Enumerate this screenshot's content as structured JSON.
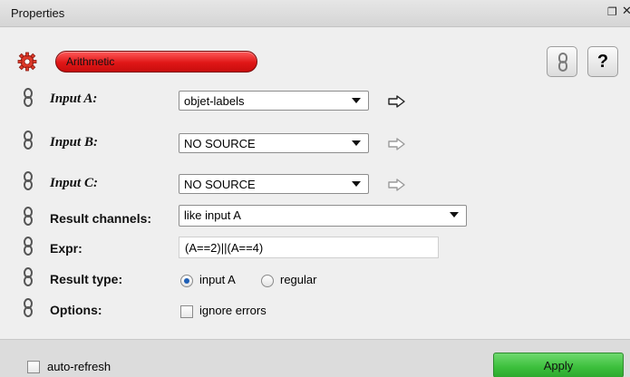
{
  "window": {
    "title": "Properties",
    "float_glyph": "❐",
    "close_glyph": "✕"
  },
  "header": {
    "module_name": "Arithmetic",
    "module_icon": "red-gear-icon",
    "link_icon": "chain-link-icon",
    "help_label": "?"
  },
  "rows": {
    "input_a": {
      "label": "Input A:",
      "value": "objet-labels",
      "arrow_active": true
    },
    "input_b": {
      "label": "Input B:",
      "value": "NO SOURCE",
      "arrow_active": false
    },
    "input_c": {
      "label": "Input C:",
      "value": "NO SOURCE",
      "arrow_active": false
    },
    "result_channels": {
      "label": "Result channels:",
      "value": "like input A"
    },
    "expr": {
      "label": "Expr:",
      "value": "(A==2)||(A==4)"
    },
    "result_type": {
      "label": "Result type:",
      "options": [
        {
          "label": "input A",
          "selected": true
        },
        {
          "label": "regular",
          "selected": false
        }
      ]
    },
    "options": {
      "label": "Options:",
      "checkbox_label": "ignore errors",
      "checked": false
    }
  },
  "footer": {
    "auto_refresh_label": "auto-refresh",
    "auto_refresh_checked": false,
    "apply_label": "Apply"
  },
  "colors": {
    "module_pill": "#e01717",
    "apply_button": "#3bbf3b",
    "radio_selected": "#1e5fb6"
  }
}
